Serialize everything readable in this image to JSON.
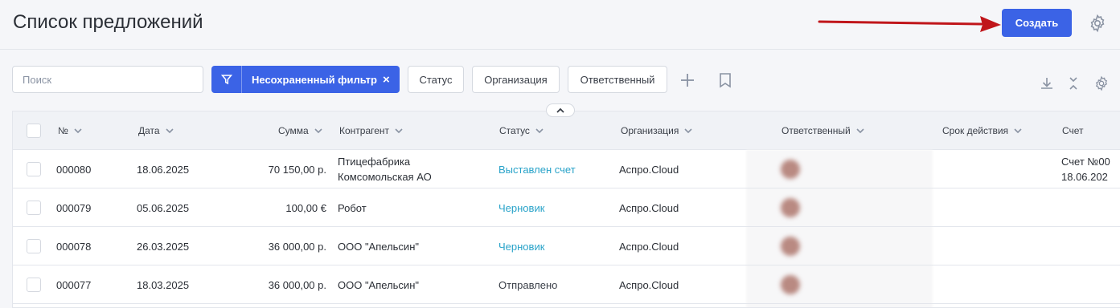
{
  "header": {
    "title": "Список предложений",
    "create_label": "Создать"
  },
  "filters": {
    "search_placeholder": "Поиск",
    "active_filter_label": "Несохраненный фильтр",
    "active_filter_clear": "×",
    "buttons": [
      "Статус",
      "Организация",
      "Ответственный"
    ]
  },
  "table": {
    "columns": [
      "№",
      "Дата",
      "Сумма",
      "Контрагент",
      "Статус",
      "Организация",
      "Ответственный",
      "Срок действия",
      "Счет"
    ],
    "rows": [
      {
        "number": "000080",
        "date": "18.06.2025",
        "amount": "70 150,00 р.",
        "counterparty": "Птицефабрика Комсомольская АО",
        "status": "Выставлен счет",
        "status_link": true,
        "organization": "Аспро.Cloud",
        "invoice": "Счет №00 18.06.202"
      },
      {
        "number": "000079",
        "date": "05.06.2025",
        "amount": "100,00 €",
        "counterparty": "Робот",
        "status": "Черновик",
        "status_link": true,
        "organization": "Аспро.Cloud",
        "invoice": ""
      },
      {
        "number": "000078",
        "date": "26.03.2025",
        "amount": "36 000,00 р.",
        "counterparty": "ООО \"Апельсин\"",
        "status": "Черновик",
        "status_link": true,
        "organization": "Аспро.Cloud",
        "invoice": ""
      },
      {
        "number": "000077",
        "date": "18.03.2025",
        "amount": "36 000,00 р.",
        "counterparty": "ООО \"Апельсин\"",
        "status": "Отправлено",
        "status_link": false,
        "organization": "Аспро.Cloud",
        "invoice": ""
      }
    ]
  },
  "colors": {
    "accent": "#3b63e6",
    "status_link": "#29a3c9",
    "arrow": "#c0161b"
  },
  "icons": [
    "gear-icon",
    "filter-icon",
    "close-icon",
    "plus-icon",
    "bookmark-icon",
    "download-icon",
    "collapse-icon",
    "chevron-down-icon",
    "chevron-up-icon"
  ]
}
